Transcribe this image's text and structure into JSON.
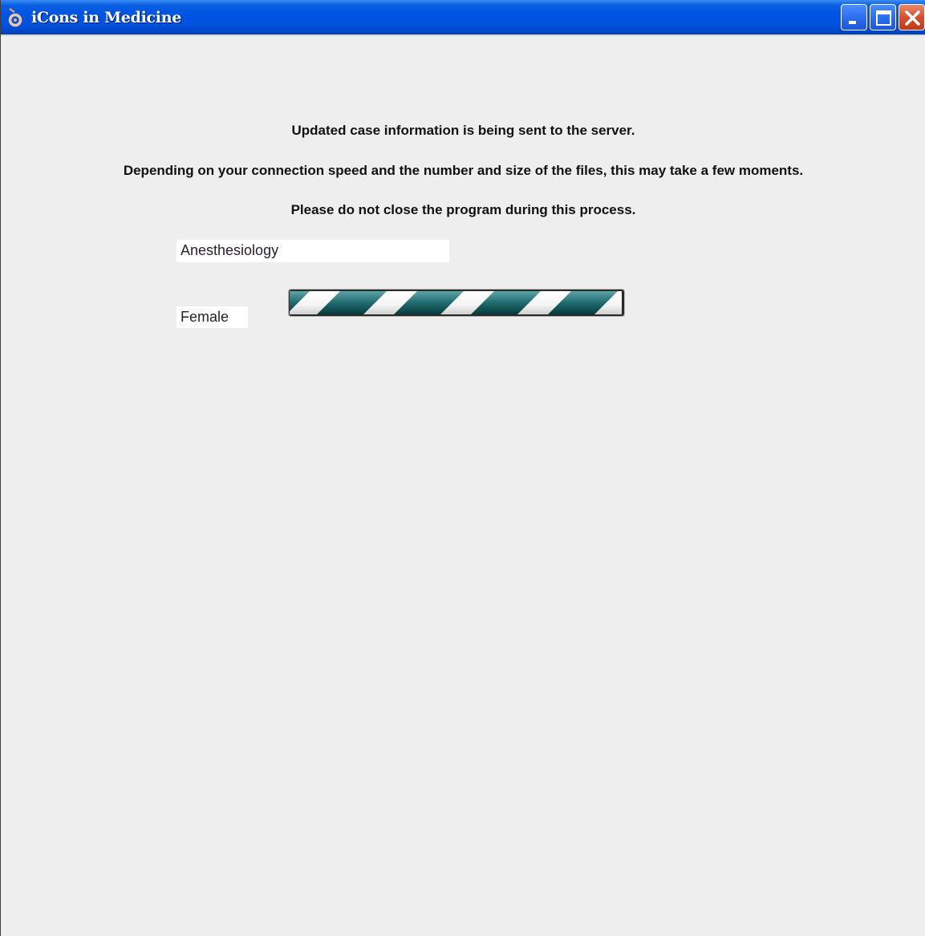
{
  "window": {
    "title": "iCons in Medicine",
    "icon": "app-logo-icon",
    "controls": [
      "minimize-icon",
      "maximize-icon",
      "close-icon"
    ]
  },
  "messages": {
    "line1": "Updated case information is being sent to the server.",
    "line2": "Depending on your connection speed and the number and size of the files, this may take a few moments.",
    "line3": "Please do not close the program during this process."
  },
  "fields": {
    "specialty": "Anesthesiology",
    "sex": "Female"
  },
  "progress": {
    "state": "indeterminate",
    "colors": {
      "stripe_dark": "#0c4f55",
      "stripe_light": "#ffffff"
    }
  }
}
